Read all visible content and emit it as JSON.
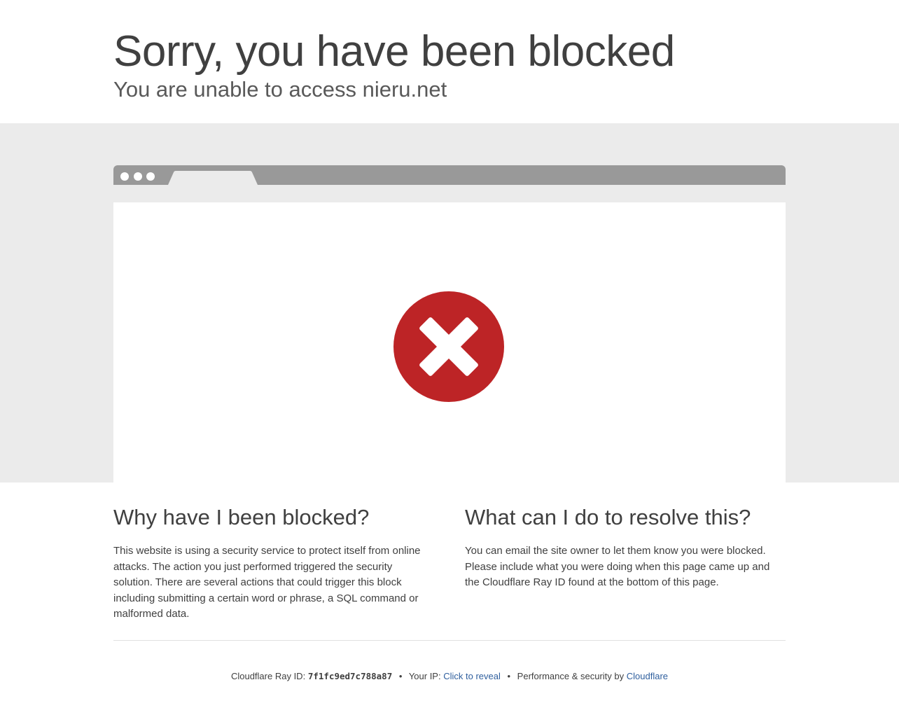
{
  "header": {
    "title": "Sorry, you have been blocked",
    "subtitle": "You are unable to access nieru.net"
  },
  "illustration": {
    "icon": "blocked-x-icon",
    "icon_color": "#bd2426"
  },
  "why": {
    "heading": "Why have I been blocked?",
    "body": "This website is using a security service to protect itself from online attacks. The action you just performed triggered the security solution. There are several actions that could trigger this block including submitting a certain word or phrase, a SQL command or malformed data."
  },
  "resolve": {
    "heading": "What can I do to resolve this?",
    "body": "You can email the site owner to let them know you were blocked. Please include what you were doing when this page came up and the Cloudflare Ray ID found at the bottom of this page."
  },
  "footer": {
    "ray_label": "Cloudflare Ray ID:",
    "ray_id": "7f1fc9ed7c788a87",
    "separator": "•",
    "ip_label": "Your IP:",
    "ip_link": "Click to reveal",
    "perf_label": "Performance & security by",
    "perf_link": "Cloudflare",
    "link_color": "#2f5f9e"
  }
}
